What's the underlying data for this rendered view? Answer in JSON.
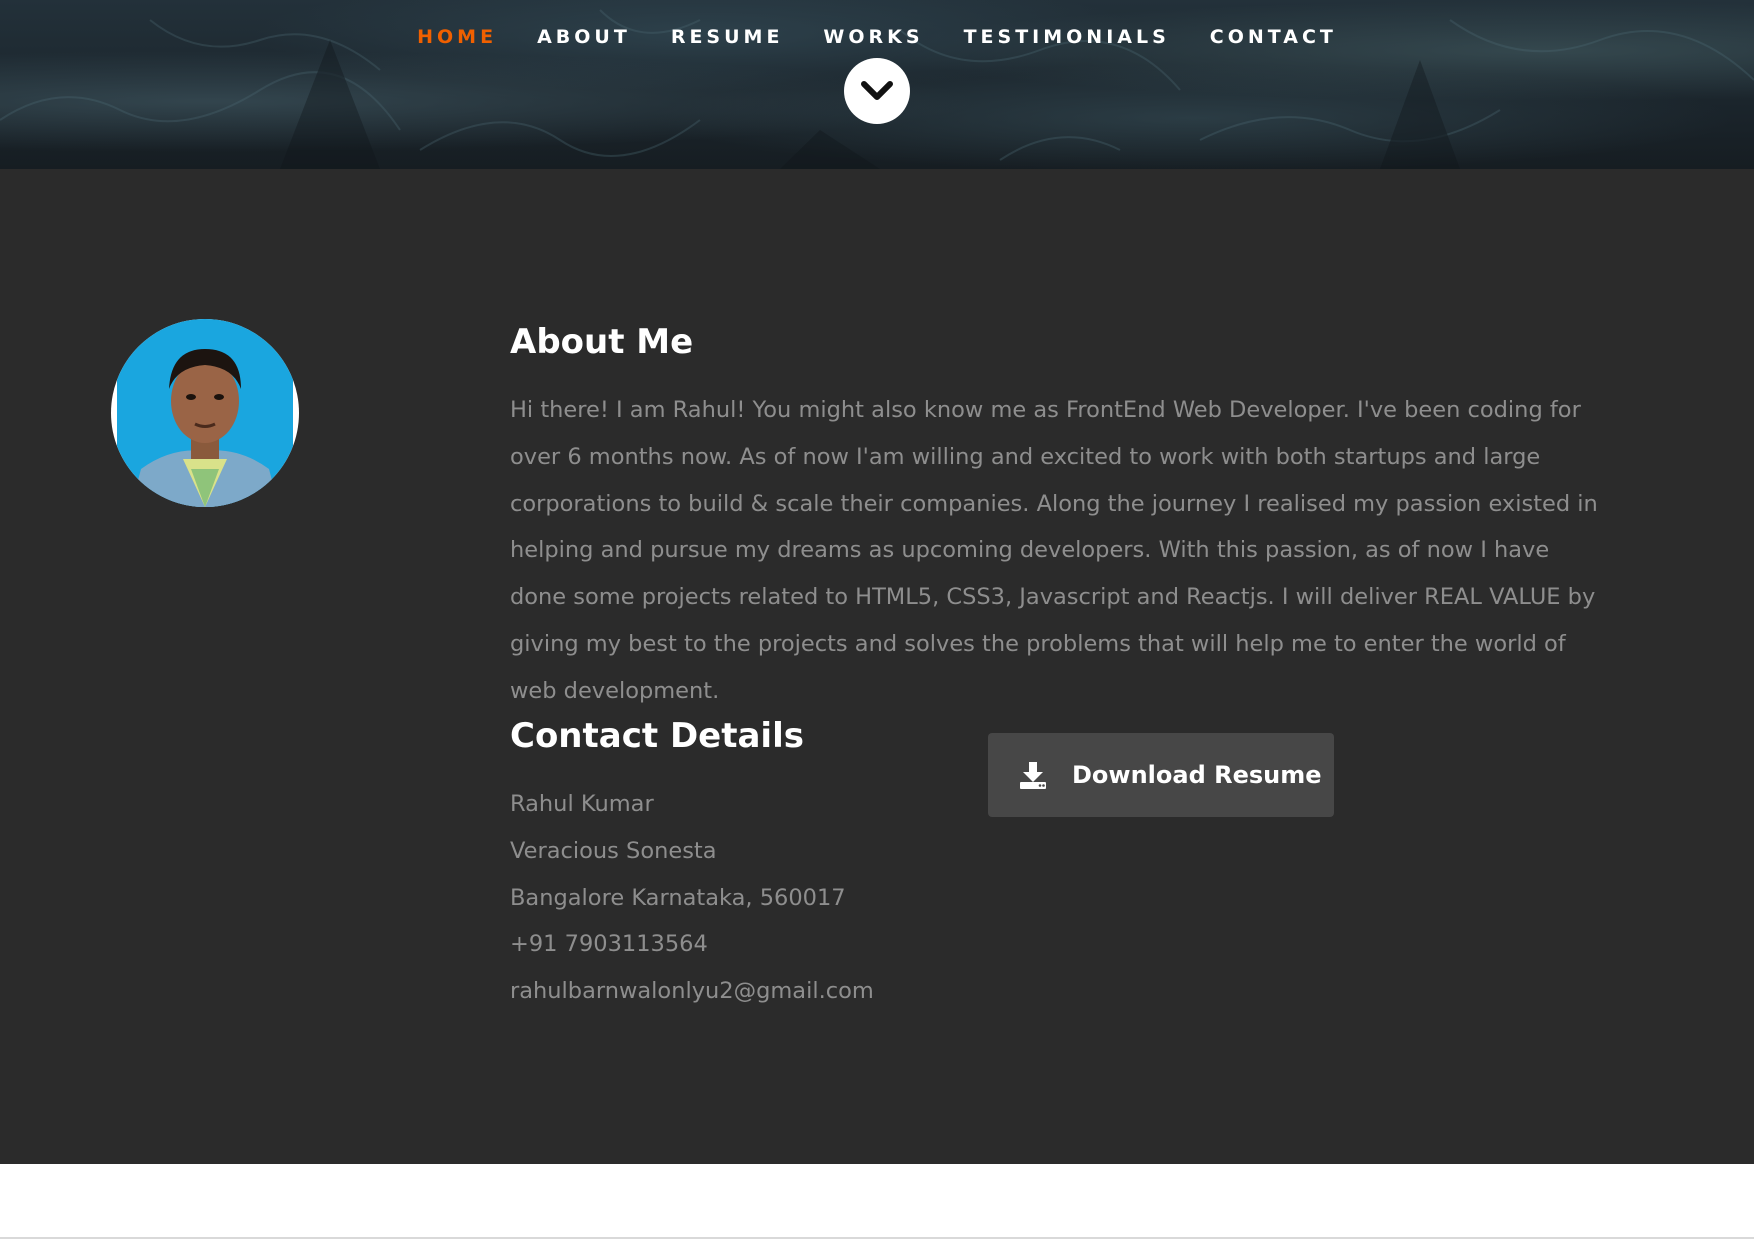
{
  "nav": {
    "items": [
      {
        "label": "HOME",
        "active": true
      },
      {
        "label": "ABOUT",
        "active": false
      },
      {
        "label": "RESUME",
        "active": false
      },
      {
        "label": "WORKS",
        "active": false
      },
      {
        "label": "TESTIMONIALS",
        "active": false
      },
      {
        "label": "CONTACT",
        "active": false
      }
    ],
    "active_color": "#f06000",
    "scroll_icon": "chevron-down-icon"
  },
  "about": {
    "title": "About Me",
    "text": "Hi there! I am Rahul! You might also know me as FrontEnd Web Developer. I've been coding for over 6 months now. As of now I'am willing and excited to work with both startups and large corporations to build & scale their companies. Along the journey I realised my passion existed in helping and pursue my dreams as upcoming developers. With this passion, as of now I have done some projects related to HTML5, CSS3, Javascript and Reactjs. I will deliver REAL VALUE by giving my best to the projects and solves the problems that will help me to enter the world of web development."
  },
  "contact": {
    "title": "Contact Details",
    "name": "Rahul Kumar",
    "address_line1": "Veracious Sonesta",
    "address_line2": "Bangalore Karnataka, 560017",
    "phone": "+91 7903113564",
    "email": "rahulbarnwalonlyu2@gmail.com"
  },
  "download": {
    "label": "Download Resume",
    "icon": "download-icon"
  },
  "colors": {
    "section_bg": "#2b2b2b",
    "text_muted": "#8e8e8e",
    "button_bg": "#474747"
  }
}
